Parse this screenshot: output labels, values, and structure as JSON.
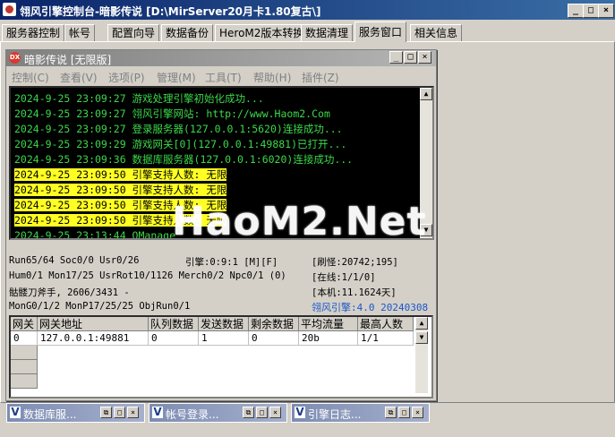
{
  "window": {
    "title": "翎风引擎控制台-暗影传说 [D:\\MirServer20月卡1.80复古\\]"
  },
  "tabs": [
    {
      "label": "服务器控制"
    },
    {
      "label": "帐号"
    },
    {
      "label": "配置向导"
    },
    {
      "label": "数据备份"
    },
    {
      "label": "HeroM2版本转换"
    },
    {
      "label": "数据清理"
    },
    {
      "label": "服务窗口",
      "active": true
    },
    {
      "label": "相关信息"
    }
  ],
  "inner_window": {
    "icon_text": "DX",
    "title": "暗影传说 [无限版]",
    "menu": [
      "控制(C)",
      "查看(V)",
      "选项(P)",
      "管理(M)",
      "工具(T)",
      "帮助(H)",
      "插件(Z)"
    ]
  },
  "console": {
    "lines": [
      {
        "text": "2024-9-25 23:09:27 游戏处理引擎初始化成功...",
        "style": "green"
      },
      {
        "text": "2024-9-25 23:09:27 翎风引擎网站: http://www.Haom2.Com",
        "style": "green"
      },
      {
        "text": "2024-9-25 23:09:27 登录服务器(127.0.0.1:5620)连接成功...",
        "style": "green"
      },
      {
        "text": "2024-9-25 23:09:29 游戏网关[0](127.0.0.1:49881)已打开...",
        "style": "green"
      },
      {
        "text": "2024-9-25 23:09:36 数据库服务器(127.0.0.1:6020)连接成功...",
        "style": "green"
      },
      {
        "text": "2024-9-25 23:09:50 引擎支持人数: 无限",
        "style": "yellow"
      },
      {
        "text": "2024-9-25 23:09:50 引擎支持人数: 无限",
        "style": "yellow"
      },
      {
        "text": "2024-9-25 23:09:50 引擎支持人数: 无限",
        "style": "yellow"
      },
      {
        "text": "2024-9-25 23:09:50 引擎支持人数: 无限",
        "style": "yellow"
      },
      {
        "text": "2024-9-25 23:13:44 QManage",
        "style": "green"
      }
    ]
  },
  "status": {
    "run": "Run65/64 Soc0/0 Usr0/26",
    "engine": "引擎:0:9:1 [M][F]",
    "monsters": "[刷怪:20742;195]",
    "hum": "Hum0/1 Mon17/25 UsrRot10/1126 Merch0/2 Npc0/1 (0)",
    "online": "[在线:1/1/0]",
    "player": "骷髅刀斧手, 2606/3431 -",
    "local": "[本机:11.1624天]",
    "mongen": "MonG0/1/2 MonP17/25/25 ObjRun0/1",
    "version": "翎风引擎:4.0 20240308"
  },
  "gate_table": {
    "columns": [
      "网关",
      "网关地址",
      "队列数据",
      "发送数据",
      "剩余数据",
      "平均流量",
      "最高人数"
    ],
    "rows": [
      [
        "0",
        "127.0.0.1:49881",
        "0",
        "1",
        "0",
        "20b",
        "1/1"
      ]
    ]
  },
  "watermark": "HaoM2.Net",
  "minimized": [
    {
      "title": "数据库服..."
    },
    {
      "title": "帐号登录..."
    },
    {
      "title": "引擎日志..."
    }
  ],
  "colors": {
    "titlebar": "#0a246a",
    "console_bg": "#000000",
    "console_green": "#3cd84a",
    "highlight_yellow": "#ffff22",
    "version_blue": "#1a56c9"
  }
}
